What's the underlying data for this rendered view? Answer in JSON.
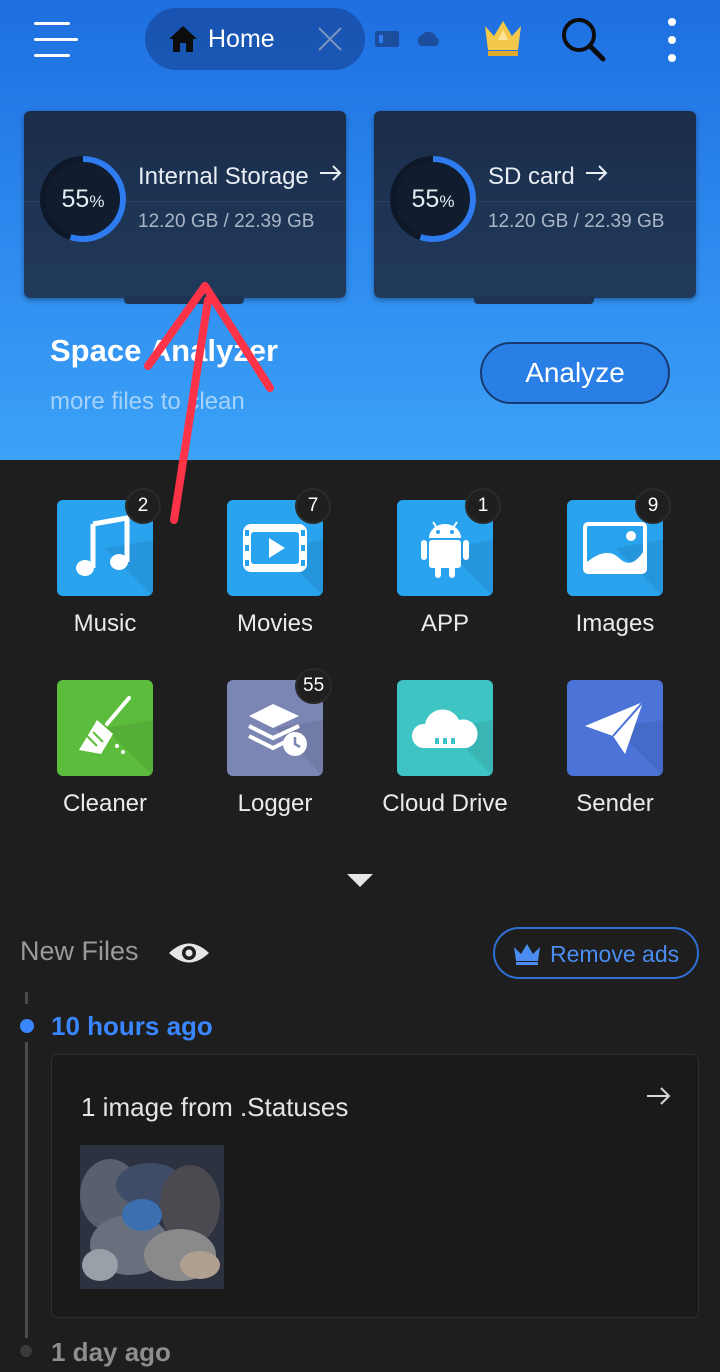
{
  "toolbar": {
    "home_tab_label": "Home"
  },
  "storage": [
    {
      "title": "Internal Storage",
      "percent_value": 55,
      "percent_label": "55",
      "percent_unit": "%",
      "usage": "12.20 GB / 22.39 GB"
    },
    {
      "title": "SD card",
      "percent_value": 55,
      "percent_label": "55",
      "percent_unit": "%",
      "usage": "12.20 GB / 22.39 GB"
    }
  ],
  "space_analyzer": {
    "title": "Space Analyzer",
    "subtitle": "more files to clean",
    "button_label": "Analyze"
  },
  "categories": [
    {
      "name": "Music",
      "badge": "2",
      "icon": "music-note-icon",
      "color": "#29a3ee"
    },
    {
      "name": "Movies",
      "badge": "7",
      "icon": "movie-film-icon",
      "color": "#29a3ee"
    },
    {
      "name": "APP",
      "badge": "1",
      "icon": "android-icon",
      "color": "#29a3ee"
    },
    {
      "name": "Images",
      "badge": "9",
      "icon": "image-icon",
      "color": "#29a3ee"
    },
    {
      "name": "Cleaner",
      "badge": "",
      "icon": "broom-icon",
      "color": "#5cbd3c"
    },
    {
      "name": "Logger",
      "badge": "55",
      "icon": "stack-clock-icon",
      "color": "#7b86b4"
    },
    {
      "name": "Cloud Drive",
      "badge": "",
      "icon": "cloud-icon",
      "color": "#3fc4c4"
    },
    {
      "name": "Sender",
      "badge": "",
      "icon": "paper-plane-icon",
      "color": "#4c73d8"
    }
  ],
  "new_files": {
    "title": "New Files",
    "remove_ads_label": "Remove ads",
    "groups": [
      {
        "time": "10 hours ago",
        "card_title": "1 image from .Statuses"
      },
      {
        "time": "1 day ago"
      }
    ]
  },
  "colors": {
    "accent": "#2f7cf0",
    "timeline_active": "#3a86ff",
    "annotation_arrow": "#ff3347"
  }
}
